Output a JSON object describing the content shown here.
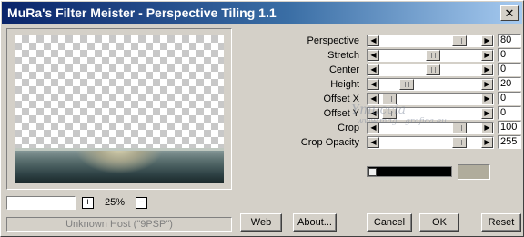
{
  "window": {
    "title": "MuRa's Filter Meister - Perspective Tiling 1.1",
    "close_glyph": "✕"
  },
  "zoom": {
    "value": "25%",
    "plus": "+",
    "minus": "−"
  },
  "status": "Unknown Host (\"9PSP\")",
  "controls": [
    {
      "label": "Perspective",
      "value": "80",
      "level": 0.82
    },
    {
      "label": "Stretch",
      "value": "0",
      "level": 0.52
    },
    {
      "label": "Center",
      "value": "0",
      "level": 0.52
    },
    {
      "label": "Height",
      "value": "20",
      "level": 0.22
    },
    {
      "label": "Offset X",
      "value": "0",
      "level": 0.02
    },
    {
      "label": "Offset Y",
      "value": "0",
      "level": 0.02
    },
    {
      "label": "Crop",
      "value": "100",
      "level": 0.82
    },
    {
      "label": "Crop Opacity",
      "value": "255",
      "level": 0.82
    }
  ],
  "watermark": {
    "line1": "Ymuccia",
    "line2": "www.mag...grafica.eu"
  },
  "swatch_color": "#b0ac9c",
  "buttons": {
    "web": "Web",
    "about": "About...",
    "cancel": "Cancel",
    "ok": "OK",
    "reset": "Reset"
  }
}
